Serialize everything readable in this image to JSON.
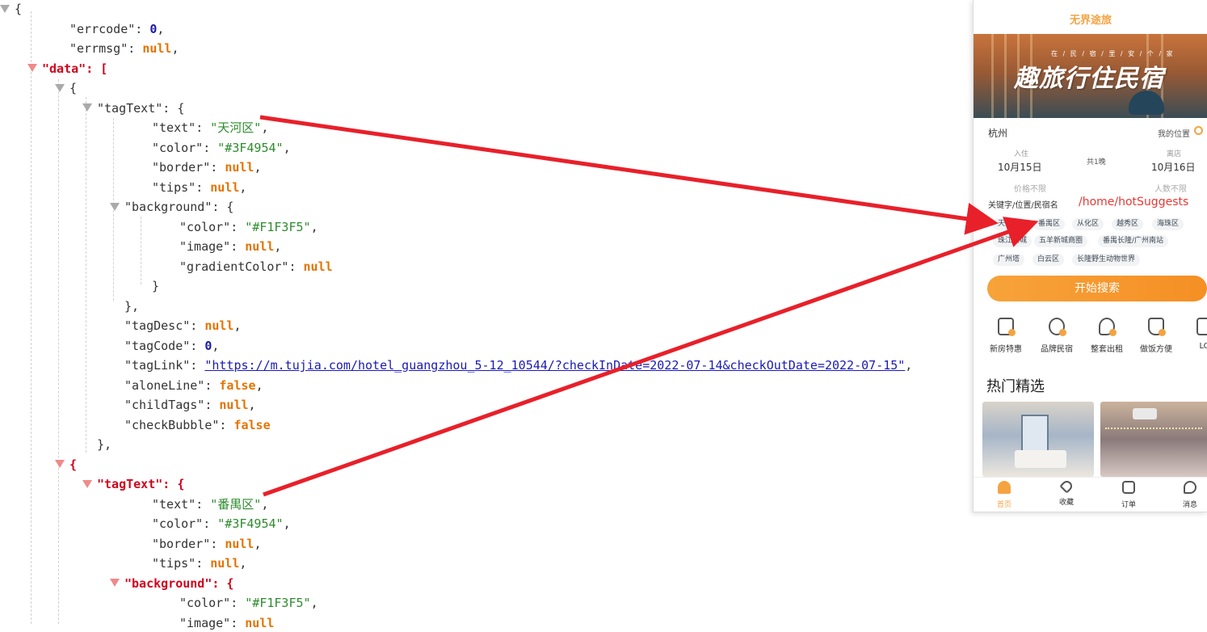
{
  "json_lines": [
    {
      "indent": 0,
      "tri": "grey",
      "parts": [
        {
          "t": "p",
          "v": "{"
        }
      ]
    },
    {
      "indent": 2,
      "parts": [
        {
          "t": "k",
          "v": "\"errcode\""
        },
        {
          "t": "p",
          "v": ": "
        },
        {
          "t": "num",
          "v": "0"
        },
        {
          "t": "p",
          "v": ","
        }
      ]
    },
    {
      "indent": 2,
      "parts": [
        {
          "t": "k",
          "v": "\"errmsg\""
        },
        {
          "t": "p",
          "v": ": "
        },
        {
          "t": "kw",
          "v": "null"
        },
        {
          "t": "p",
          "v": ","
        }
      ]
    },
    {
      "indent": 1,
      "tri": "red",
      "parts": [
        {
          "t": "kr",
          "v": "\"data\""
        },
        {
          "t": "pr",
          "v": ": ["
        }
      ]
    },
    {
      "indent": 2,
      "tri": "grey",
      "parts": [
        {
          "t": "p",
          "v": "{"
        }
      ]
    },
    {
      "indent": 3,
      "tri": "grey",
      "parts": [
        {
          "t": "k",
          "v": "\"tagText\""
        },
        {
          "t": "p",
          "v": ": {"
        }
      ]
    },
    {
      "indent": 5,
      "parts": [
        {
          "t": "k",
          "v": "\"text\""
        },
        {
          "t": "p",
          "v": ": "
        },
        {
          "t": "str",
          "v": "\"天河区\""
        },
        {
          "t": "p",
          "v": ","
        }
      ]
    },
    {
      "indent": 5,
      "parts": [
        {
          "t": "k",
          "v": "\"color\""
        },
        {
          "t": "p",
          "v": ": "
        },
        {
          "t": "str",
          "v": "\"#3F4954\""
        },
        {
          "t": "p",
          "v": ","
        }
      ]
    },
    {
      "indent": 5,
      "parts": [
        {
          "t": "k",
          "v": "\"border\""
        },
        {
          "t": "p",
          "v": ": "
        },
        {
          "t": "kw",
          "v": "null"
        },
        {
          "t": "p",
          "v": ","
        }
      ]
    },
    {
      "indent": 5,
      "parts": [
        {
          "t": "k",
          "v": "\"tips\""
        },
        {
          "t": "p",
          "v": ": "
        },
        {
          "t": "kw",
          "v": "null"
        },
        {
          "t": "p",
          "v": ","
        }
      ]
    },
    {
      "indent": 4,
      "tri": "grey",
      "parts": [
        {
          "t": "k",
          "v": "\"background\""
        },
        {
          "t": "p",
          "v": ": {"
        }
      ]
    },
    {
      "indent": 6,
      "parts": [
        {
          "t": "k",
          "v": "\"color\""
        },
        {
          "t": "p",
          "v": ": "
        },
        {
          "t": "str",
          "v": "\"#F1F3F5\""
        },
        {
          "t": "p",
          "v": ","
        }
      ]
    },
    {
      "indent": 6,
      "parts": [
        {
          "t": "k",
          "v": "\"image\""
        },
        {
          "t": "p",
          "v": ": "
        },
        {
          "t": "kw",
          "v": "null"
        },
        {
          "t": "p",
          "v": ","
        }
      ]
    },
    {
      "indent": 6,
      "parts": [
        {
          "t": "k",
          "v": "\"gradientColor\""
        },
        {
          "t": "p",
          "v": ": "
        },
        {
          "t": "kw",
          "v": "null"
        }
      ]
    },
    {
      "indent": 5,
      "parts": [
        {
          "t": "p",
          "v": "}"
        }
      ]
    },
    {
      "indent": 4,
      "parts": [
        {
          "t": "p",
          "v": "},"
        }
      ]
    },
    {
      "indent": 4,
      "parts": [
        {
          "t": "k",
          "v": "\"tagDesc\""
        },
        {
          "t": "p",
          "v": ": "
        },
        {
          "t": "kw",
          "v": "null"
        },
        {
          "t": "p",
          "v": ","
        }
      ]
    },
    {
      "indent": 4,
      "parts": [
        {
          "t": "k",
          "v": "\"tagCode\""
        },
        {
          "t": "p",
          "v": ": "
        },
        {
          "t": "num",
          "v": "0"
        },
        {
          "t": "p",
          "v": ","
        }
      ]
    },
    {
      "indent": 4,
      "parts": [
        {
          "t": "k",
          "v": "\"tagLink\""
        },
        {
          "t": "p",
          "v": ": "
        },
        {
          "t": "lnk",
          "v": "\"https://m.tujia.com/hotel_guangzhou_5-12_10544/?checkInDate=2022-07-14&checkOutDate=2022-07-15\""
        },
        {
          "t": "p",
          "v": ","
        }
      ]
    },
    {
      "indent": 4,
      "parts": [
        {
          "t": "k",
          "v": "\"aloneLine\""
        },
        {
          "t": "p",
          "v": ": "
        },
        {
          "t": "kw",
          "v": "false"
        },
        {
          "t": "p",
          "v": ","
        }
      ]
    },
    {
      "indent": 4,
      "parts": [
        {
          "t": "k",
          "v": "\"childTags\""
        },
        {
          "t": "p",
          "v": ": "
        },
        {
          "t": "kw",
          "v": "null"
        },
        {
          "t": "p",
          "v": ","
        }
      ]
    },
    {
      "indent": 4,
      "parts": [
        {
          "t": "k",
          "v": "\"checkBubble\""
        },
        {
          "t": "p",
          "v": ": "
        },
        {
          "t": "kw",
          "v": "false"
        }
      ]
    },
    {
      "indent": 3,
      "parts": [
        {
          "t": "p",
          "v": "},"
        }
      ]
    },
    {
      "indent": 2,
      "tri": "red",
      "parts": [
        {
          "t": "pr",
          "v": "{"
        }
      ]
    },
    {
      "indent": 3,
      "tri": "red",
      "parts": [
        {
          "t": "kr",
          "v": "\"tagText\""
        },
        {
          "t": "pr",
          "v": ": {"
        }
      ]
    },
    {
      "indent": 5,
      "parts": [
        {
          "t": "k",
          "v": "\"text\""
        },
        {
          "t": "p",
          "v": ": "
        },
        {
          "t": "str",
          "v": "\"番禺区\""
        },
        {
          "t": "p",
          "v": ","
        }
      ]
    },
    {
      "indent": 5,
      "parts": [
        {
          "t": "k",
          "v": "\"color\""
        },
        {
          "t": "p",
          "v": ": "
        },
        {
          "t": "str",
          "v": "\"#3F4954\""
        },
        {
          "t": "p",
          "v": ","
        }
      ]
    },
    {
      "indent": 5,
      "parts": [
        {
          "t": "k",
          "v": "\"border\""
        },
        {
          "t": "p",
          "v": ": "
        },
        {
          "t": "kw",
          "v": "null"
        },
        {
          "t": "p",
          "v": ","
        }
      ]
    },
    {
      "indent": 5,
      "parts": [
        {
          "t": "k",
          "v": "\"tips\""
        },
        {
          "t": "p",
          "v": ": "
        },
        {
          "t": "kw",
          "v": "null"
        },
        {
          "t": "p",
          "v": ","
        }
      ]
    },
    {
      "indent": 4,
      "tri": "red",
      "parts": [
        {
          "t": "kr",
          "v": "\"background\""
        },
        {
          "t": "pr",
          "v": ": {"
        }
      ]
    },
    {
      "indent": 6,
      "parts": [
        {
          "t": "k",
          "v": "\"color\""
        },
        {
          "t": "p",
          "v": ": "
        },
        {
          "t": "str",
          "v": "\"#F1F3F5\""
        },
        {
          "t": "p",
          "v": ","
        }
      ]
    },
    {
      "indent": 6,
      "parts": [
        {
          "t": "k",
          "v": "\"image\""
        },
        {
          "t": "p",
          "v": ": "
        },
        {
          "t": "kw",
          "v": "null"
        }
      ]
    }
  ],
  "phone": {
    "app_title": "无界途旅",
    "banner": {
      "subtitle": "在 / 民 / 宿 / 里 / 安 / 个 / 家",
      "title": "趣旅行住民宿"
    },
    "city": "杭州",
    "my_location": "我的位置",
    "checkin": {
      "label": "入住",
      "date": "10月15日"
    },
    "nights": "共1晚",
    "checkout": {
      "label": "离店",
      "date": "10月16日"
    },
    "price": "价格不限",
    "guests": "人数不限",
    "keyword_label": "关键字/位置/民宿名",
    "overlay_text": "/home/hotSuggests",
    "tags": [
      "天河区",
      "番禺区",
      "从化区",
      "越秀区",
      "海珠区",
      "珠江新城",
      "五羊新城商圈",
      "番禺长隆/广州南站",
      "广州塔",
      "白云区",
      "长隆野生动物世界"
    ],
    "search_button": "开始搜索",
    "features": [
      "新房特惠",
      "品牌民宿",
      "整套出租",
      "做饭方便",
      "LO"
    ],
    "section_title": "热门精选",
    "tabbar": [
      "首页",
      "收藏",
      "订单",
      "消息"
    ]
  },
  "colors": {
    "accent": "#f5a341",
    "arrow": "#e8202a",
    "key_highlight": "#d0021b",
    "string": "#2e8b2e",
    "keyword": "#e67300",
    "number": "#1a1aa6"
  }
}
